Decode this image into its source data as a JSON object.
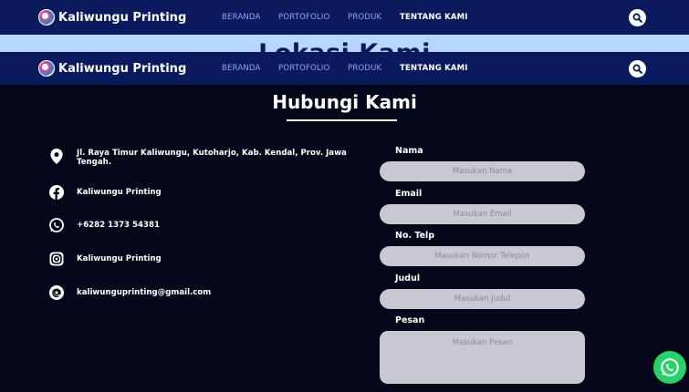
{
  "brand": {
    "name": "Kaliwungu Printing"
  },
  "nav": {
    "items": [
      {
        "label": "BERANDA",
        "active": false
      },
      {
        "label": "PORTOFOLIO",
        "active": false
      },
      {
        "label": "PRODUK",
        "active": false
      },
      {
        "label": "TENTANG KAMI",
        "active": true
      }
    ]
  },
  "lokasi": {
    "title": "Lokasi Kami"
  },
  "contact": {
    "title": "Hubungi Kami",
    "items": [
      {
        "icon": "location-icon",
        "text": "Jl. Raya Timur Kaliwungu, Kutoharjo, Kab. Kendal, Prov. Jawa Tengah."
      },
      {
        "icon": "facebook-icon",
        "text": "Kaliwungu Printing"
      },
      {
        "icon": "whatsapp-icon",
        "text": "+6282 1373 54381"
      },
      {
        "icon": "instagram-icon",
        "text": "Kaliwungu Printing"
      },
      {
        "icon": "email-icon",
        "text": "kaliwunguprinting@gmail.com"
      }
    ]
  },
  "form": {
    "nama": {
      "label": "Nama",
      "placeholder": "Masukan Nama"
    },
    "email": {
      "label": "Email",
      "placeholder": "Masukan Email"
    },
    "telp": {
      "label": "No. Telp",
      "placeholder": "Masukan Nomor Telepon"
    },
    "judul": {
      "label": "Judul",
      "placeholder": "Masukan Judul"
    },
    "pesan": {
      "label": "Pesan",
      "placeholder": "Masukan Pesan"
    }
  },
  "colors": {
    "navbar": "#0a1a5c",
    "background": "#04081a",
    "accent": "#25d366",
    "band": "#b8d6ff"
  }
}
